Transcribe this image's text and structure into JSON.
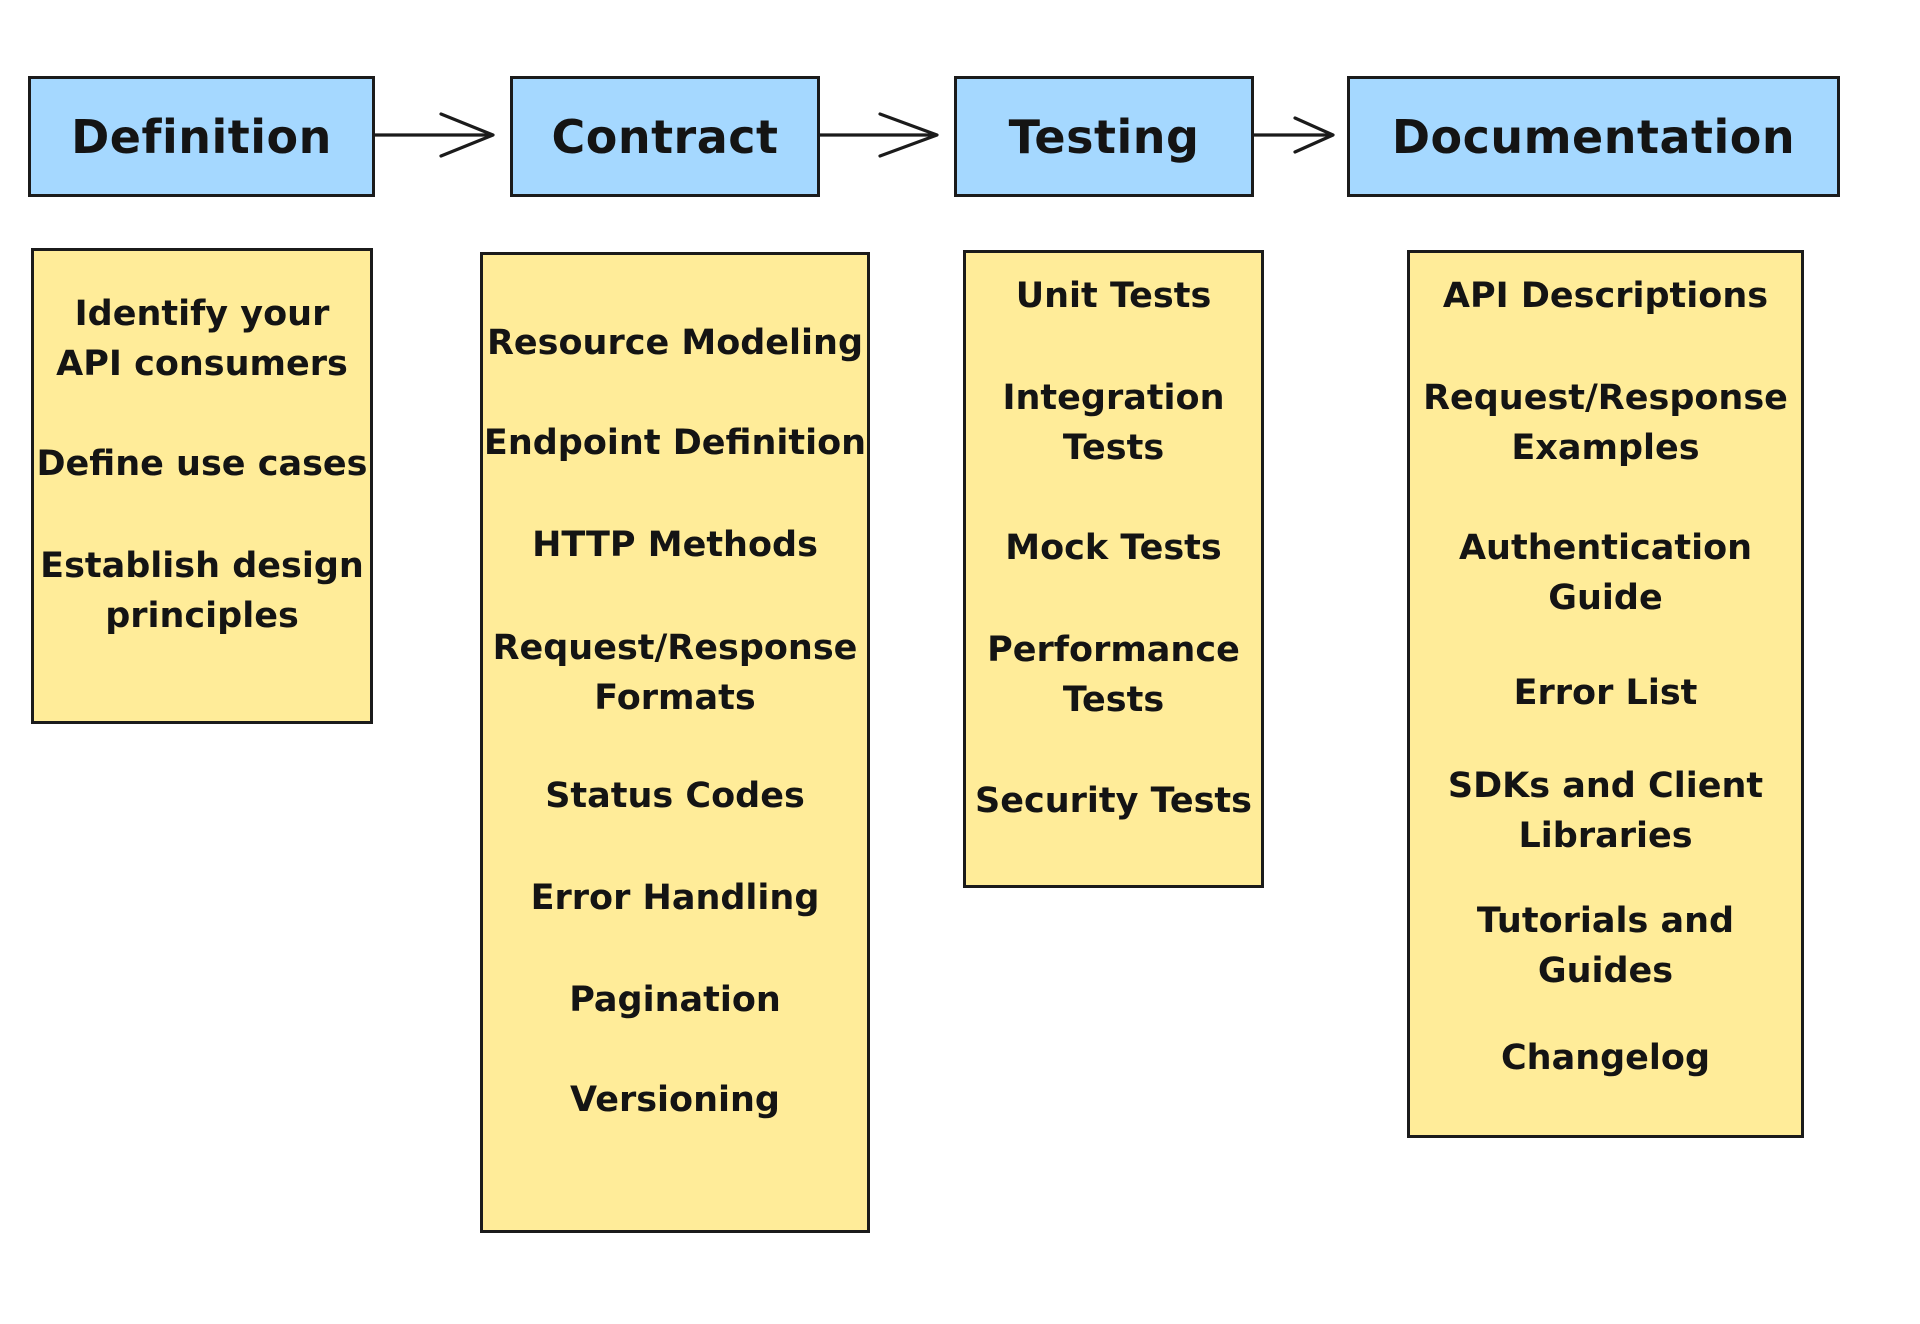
{
  "diagram": {
    "type": "flow",
    "colors": {
      "phase_fill": "#a5d8ff",
      "item_fill": "#ffec99",
      "stroke": "#1b1b1b"
    },
    "phases": [
      {
        "label": "Definition",
        "items": [
          "Identify your\nAPI consumers",
          "Define use cases",
          "Establish design\nprinciples"
        ]
      },
      {
        "label": "Contract",
        "items": [
          "Resource Modeling",
          "Endpoint Definition",
          "HTTP Methods",
          "Request/Response\nFormats",
          "Status Codes",
          "Error Handling",
          "Pagination",
          "Versioning"
        ]
      },
      {
        "label": "Testing",
        "items": [
          "Unit Tests",
          "Integration\nTests",
          "Mock Tests",
          "Performance\nTests",
          "Security Tests"
        ]
      },
      {
        "label": "Documentation",
        "items": [
          "API Descriptions",
          "Request/Response\nExamples",
          "Authentication\nGuide",
          "Error List",
          "SDKs and Client\nLibraries",
          "Tutorials and\nGuides",
          "Changelog"
        ]
      }
    ],
    "connections": [
      {
        "from": "Definition",
        "to": "Contract"
      },
      {
        "from": "Contract",
        "to": "Testing"
      },
      {
        "from": "Testing",
        "to": "Documentation"
      }
    ]
  }
}
